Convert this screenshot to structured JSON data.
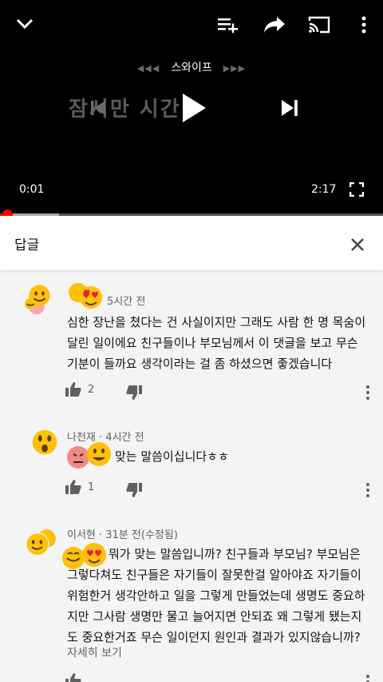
{
  "player": {
    "swipe_label": "스와이프",
    "swipe_arrows_left": "◀◀◀",
    "swipe_arrows_right": "▶▶▶",
    "caption_text": "잠시만 시간",
    "current_time": "0:01",
    "duration": "2:17",
    "progress_fraction": 0.007,
    "buffer_fraction": 0.155
  },
  "panel": {
    "title": "답글"
  },
  "comments": [
    {
      "author": "",
      "time": "5시간 전",
      "text": "심한 장난을 쳤다는 건 사실이지만 그래도 사람 한 명 목숨이 달린 일이에요 친구들이나 부모님께서 이 댓글을 보고 무슨 기분이 들까요 생각이라는 걸 좀 하셨으면 좋겠습니다",
      "likes": "2"
    },
    {
      "author": "나천재",
      "time": "4시간 전",
      "text": "맞는 말씀이십니다ㅎㅎ",
      "likes": "1"
    },
    {
      "author": "이서현",
      "time": "31분 전(수정됨)",
      "text": "뭐가 맞는 말씀입니까? 친구들과 부모님? 부모님은 그렇다쳐도 친구들은 자기들이 잘못한걸 알아야죠 자기들이 위험한거 생각안하고 일을 그렇게 만들었는데 생명도 중요하지만 그사람 생명만 물고 늘어지면 안되죠 왜 그렇게 됐는지도 중요한거죠 무슨 일이던지 원인과 결과가 있지않습니까?",
      "read_more": "자세히 보기"
    }
  ],
  "colors": {
    "progress": "#ff0000",
    "emoji_yellow": "#ffc107",
    "emoji_heart": "#e8223a"
  }
}
